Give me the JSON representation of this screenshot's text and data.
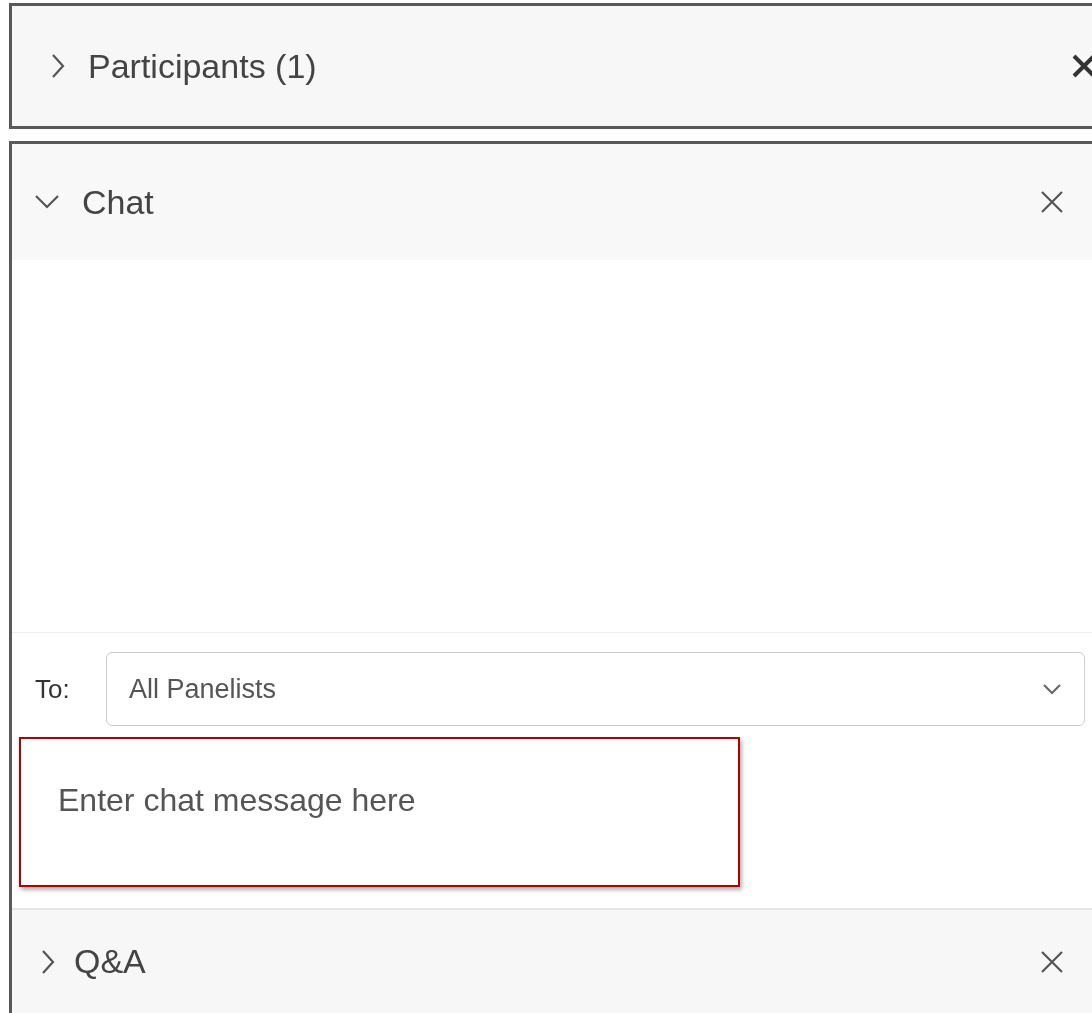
{
  "participants_panel": {
    "title": "Participants (1)",
    "expanded": false
  },
  "chat_panel": {
    "title": "Chat",
    "expanded": true,
    "recipient_label": "To:",
    "recipient": "All Panelists",
    "message": {
      "placeholder": "Enter chat message here"
    }
  },
  "qa_panel": {
    "title": "Q&A",
    "expanded": false
  }
}
